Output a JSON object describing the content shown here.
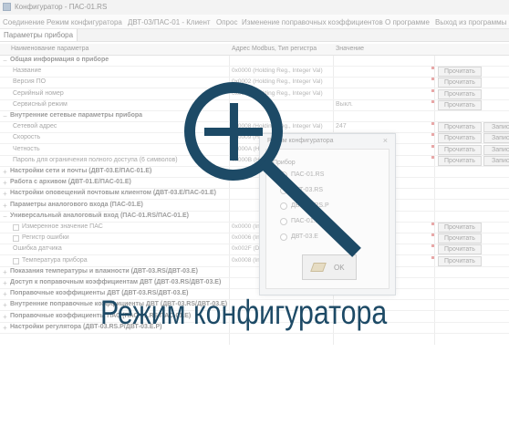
{
  "window": {
    "title": "Конфигуратор - ПАС-01.RS"
  },
  "menu": [
    "Соединение",
    "Режим конфигуратора",
    "ДВТ-03/ПАС-01 - Клиент",
    "Опрос",
    "Изменение поправочных коэффициентов",
    "О программе",
    "Выход из программы"
  ],
  "tab": {
    "label": "Параметры прибора"
  },
  "grid": {
    "columns": [
      "Наименование параметра",
      "Адрес Modbus, Тип регистра",
      "Значение"
    ],
    "rows": [
      {
        "type": "group",
        "name": "Общая информация о приборе",
        "expander": "−"
      },
      {
        "type": "item",
        "name": "Название",
        "addr": "0x0000 (Holding Reg., Integer Val)",
        "value": "",
        "buttons": [
          "Прочитать"
        ]
      },
      {
        "type": "item",
        "name": "Версия ПО",
        "addr": "0x0002 (Holding Reg., Integer Val)",
        "value": "",
        "buttons": [
          "Прочитать"
        ]
      },
      {
        "type": "item",
        "name": "Серийный номер",
        "addr": "0x0004 (Holding Reg., Integer Val)",
        "value": "",
        "buttons": [
          "Прочитать"
        ]
      },
      {
        "type": "item",
        "name": "Сервисный режим",
        "addr": "",
        "value": "Выкл.",
        "buttons": [
          "Прочитать"
        ]
      },
      {
        "type": "group",
        "name": "Внутренние сетевые параметры прибора",
        "expander": "−"
      },
      {
        "type": "item",
        "name": "Сетевой адрес",
        "addr": "0x0008 (Holding Reg., Integer Val)",
        "value": "247",
        "buttons": [
          "Прочитать",
          "Записать"
        ]
      },
      {
        "type": "item",
        "name": "Скорость",
        "addr": "0x0009 (Holding Reg.)",
        "value": "",
        "buttons": [
          "Прочитать",
          "Записать"
        ]
      },
      {
        "type": "item",
        "name": "Четность",
        "addr": "0x000A (Holding Reg.)",
        "value": "",
        "buttons": [
          "Прочитать",
          "Записать"
        ]
      },
      {
        "type": "item",
        "name": "Пароль для ограничения полного доступа (6 символов)",
        "addr": "0x000B (Holding Reg.)",
        "value": "",
        "buttons": [
          "Прочитать",
          "Записать"
        ]
      },
      {
        "type": "group",
        "name": "Настройки сети и почты (ДВТ-03.Е/ПАС-01.Е)",
        "expander": "+"
      },
      {
        "type": "group",
        "name": "Работа с архивом (ДВТ-01.Е/ПАС-01.Е)",
        "expander": "+"
      },
      {
        "type": "group",
        "name": "Настройки оповещений почтовым клиентом (ДВТ-03.Е/ПАС-01.Е)",
        "expander": "+"
      },
      {
        "type": "group",
        "name": "Параметры аналогового входа (ПАС-01.Е)",
        "expander": "+"
      },
      {
        "type": "group",
        "name": "Универсальный аналоговый вход (ПАС-01.RS/ПАС-01.Е)",
        "expander": "−"
      },
      {
        "type": "check",
        "name": "Измеренное значение ПАС",
        "addr": "0x0000 (Input Reg., Float Val)",
        "value": "",
        "buttons": [
          "Прочитать"
        ]
      },
      {
        "type": "check",
        "name": "Регистр ошибки",
        "addr": "0x0006 (Input Reg., Integer Val)",
        "value": "",
        "buttons": [
          "Прочитать"
        ]
      },
      {
        "type": "item",
        "name": "Ошибка датчика",
        "addr": "0x002F (Discrete Input)",
        "value": "",
        "buttons": [
          "Прочитать"
        ]
      },
      {
        "type": "check",
        "name": "Температура прибора",
        "addr": "0x0008 (Input Reg., Float Val)",
        "value": "",
        "buttons": [
          "Прочитать"
        ]
      },
      {
        "type": "group",
        "name": "Показания температуры и влажности (ДВТ-03.RS/ДВТ-03.Е)",
        "expander": "+"
      },
      {
        "type": "group",
        "name": "Доступ к поправочным коэффициентам ДВТ (ДВТ-03.RS/ДВТ-03.Е)",
        "expander": "+"
      },
      {
        "type": "group",
        "name": "Поправочные коэффициенты ДВТ (ДВТ-03.RS/ДВТ-03.Е)",
        "expander": "+"
      },
      {
        "type": "group",
        "name": "Внутренние поправочные коэффициенты ДВТ (ДВТ-03.RS/ДВТ-03.Е)",
        "expander": "+"
      },
      {
        "type": "group",
        "name": "Поправочные коэффициенты ПАС (ПАС-01.RS/ПАС-01.Е)",
        "expander": "+"
      },
      {
        "type": "group",
        "name": "Настройки регулятора (ДВТ-03.RS.P/ДВТ-03.Е.Р)",
        "expander": "+"
      }
    ]
  },
  "dialog": {
    "title": "Режим конфигуратора",
    "close": "×",
    "group_label": "Прибор",
    "options": [
      "ПАС-01.RS",
      "ДВТ-03.RS",
      "ДВТ-03.RS.P",
      "ПАС-01.Е",
      "ДВТ-03.Е"
    ],
    "ok_label": "OK"
  },
  "overlay": {
    "icon": "zoom-in-magnifier-icon",
    "caption": "Режим конфигуратора",
    "color": "#1d4a66"
  }
}
